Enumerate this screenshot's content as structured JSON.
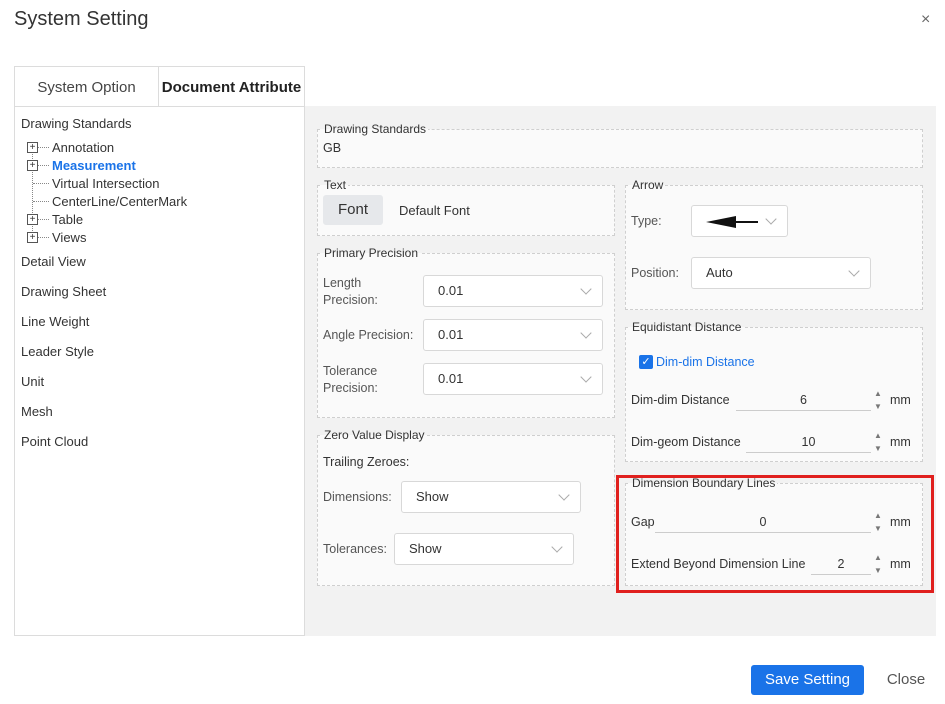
{
  "dialog": {
    "title": "System Setting",
    "close_glyph": "×"
  },
  "tabs": [
    {
      "label": "System Option",
      "active": false
    },
    {
      "label": "Document Attribute",
      "active": true
    }
  ],
  "sidebar": {
    "group_title": "Drawing Standards",
    "tree": [
      {
        "label": "Annotation",
        "expandable": true
      },
      {
        "label": "Measurement",
        "expandable": true,
        "active": true
      },
      {
        "label": "Virtual Intersection",
        "expandable": false
      },
      {
        "label": "CenterLine/CenterMark",
        "expandable": false
      },
      {
        "label": "Table",
        "expandable": true
      },
      {
        "label": "Views",
        "expandable": true
      }
    ],
    "items": [
      "Detail View",
      "Drawing Sheet",
      "Line Weight",
      "Leader Style",
      "Unit",
      "Mesh",
      "Point Cloud"
    ],
    "expand_glyph": "+"
  },
  "drawing_standards": {
    "legend": "Drawing Standards",
    "value": "GB"
  },
  "text_group": {
    "legend": "Text",
    "font_button": "Font",
    "font_value": "Default Font"
  },
  "primary_precision": {
    "legend": "Primary Precision",
    "length_label_1": "Length",
    "length_label_2": "Precision:",
    "length_value": "0.01",
    "angle_label": "Angle Precision:",
    "angle_value": "0.01",
    "tolerance_label_1": "Tolerance",
    "tolerance_label_2": "Precision:",
    "tolerance_value": "0.01"
  },
  "zero_value_display": {
    "legend": "Zero Value Display",
    "trailing_zeroes": "Trailing Zeroes:",
    "dimensions_label": "Dimensions:",
    "dimensions_value": "Show",
    "tolerances_label": "Tolerances:",
    "tolerances_value": "Show"
  },
  "arrow": {
    "legend": "Arrow",
    "type_label": "Type:",
    "type_icon": "left-arrow-icon",
    "position_label": "Position:",
    "position_value": "Auto"
  },
  "equidistant_distance": {
    "legend": "Equidistant Distance",
    "checkbox_label": "Dim-dim Distance",
    "checkbox_checked": true,
    "check_glyph": "✓",
    "dim_dim_label": "Dim-dim Distance",
    "dim_dim_value": "6",
    "dim_geom_label": "Dim-geom Distance",
    "dim_geom_value": "10",
    "unit": "mm"
  },
  "dimension_boundary_lines": {
    "legend": "Dimension Boundary Lines",
    "gap_label": "Gap",
    "gap_value": "0",
    "extend_label": "Extend Beyond Dimension Line",
    "extend_value": "2",
    "unit": "mm"
  },
  "spinner": {
    "up": "▲",
    "down": "▼"
  },
  "footer": {
    "save_label": "Save Setting",
    "close_label": "Close"
  },
  "colors": {
    "accent": "#1a73e8",
    "highlight": "#e0201e"
  }
}
